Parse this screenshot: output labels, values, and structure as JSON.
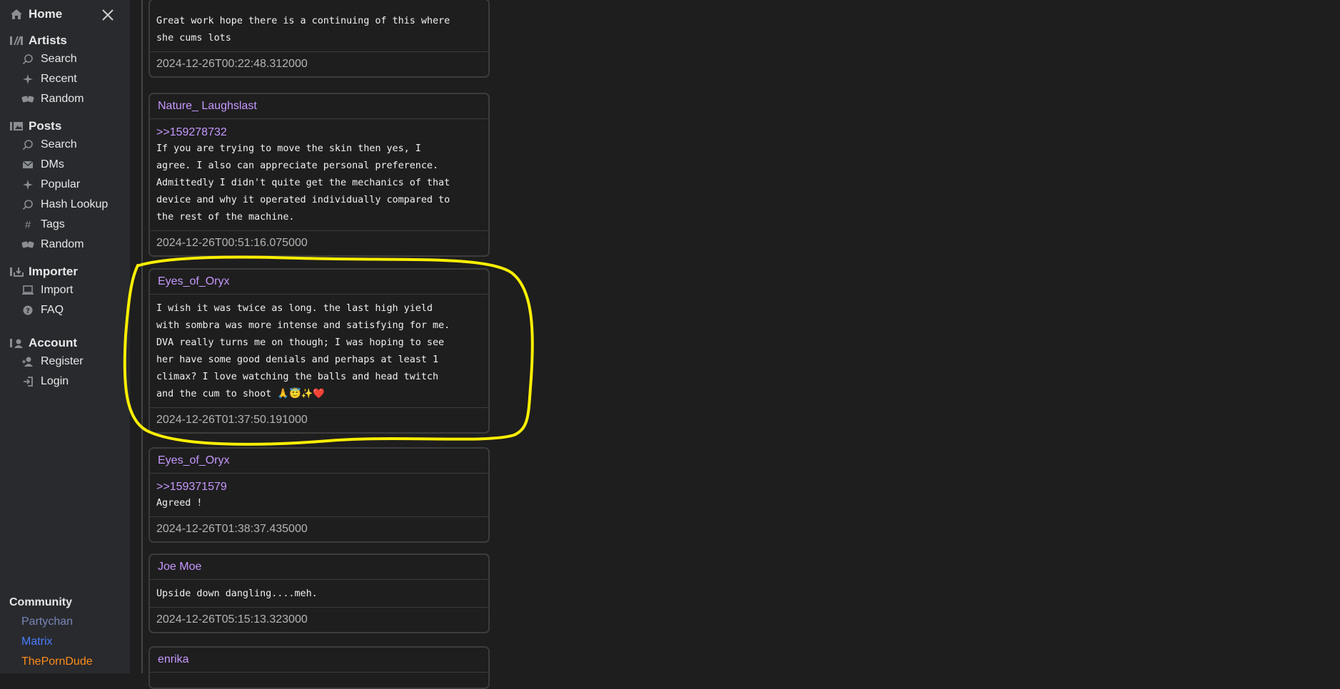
{
  "sidebar": {
    "home_label": "Home",
    "sections": [
      {
        "title": "Artists",
        "items": [
          "Search",
          "Recent",
          "Random"
        ]
      },
      {
        "title": "Posts",
        "items": [
          "Search",
          "DMs",
          "Popular",
          "Hash Lookup",
          "Tags",
          "Random"
        ]
      },
      {
        "title": "Importer",
        "items": [
          "Import",
          "FAQ"
        ]
      },
      {
        "title": "Account",
        "items": [
          "Register",
          "Login"
        ]
      }
    ],
    "community": {
      "title": "Community",
      "links": [
        {
          "label": "Partychan",
          "color": "#7a86b8"
        },
        {
          "label": "Matrix",
          "color": "#4a7dff"
        },
        {
          "label": "ThePornDude",
          "color": "#ff8c1a"
        }
      ]
    }
  },
  "comments": [
    {
      "author": "",
      "reply": "",
      "body": "Great work hope there is a continuing of this where\nshe cums lots",
      "date": "2024-12-26T00:22:48.312000"
    },
    {
      "author": "Nature_ Laughslast",
      "reply": ">>159278732",
      "body": "If you are trying to move the skin then yes, I\nagree. I also can appreciate personal preference.\nAdmittedly I didn't quite get the mechanics of that\ndevice and why it operated individually compared to\nthe rest of the machine.",
      "date": "2024-12-26T00:51:16.075000"
    },
    {
      "author": "Eyes_of_Oryx",
      "reply": "",
      "body": "I wish it was twice as long. the last high yield\nwith sombra was more intense and satisfying for me.\nDVA really turns me on though; I was hoping to see\nher have some good denials and perhaps at least 1\nclimax? I love watching the balls and head twitch\nand the cum to shoot 🙏😇✨❤️",
      "date": "2024-12-26T01:37:50.191000"
    },
    {
      "author": "Eyes_of_Oryx",
      "reply": ">>159371579",
      "body": "Agreed !",
      "date": "2024-12-26T01:38:37.435000"
    },
    {
      "author": "Joe Moe",
      "reply": "",
      "body": "Upside down dangling....meh.",
      "date": "2024-12-26T05:15:13.323000"
    },
    {
      "author": "enrika",
      "reply": "",
      "body": "",
      "date": ""
    }
  ]
}
